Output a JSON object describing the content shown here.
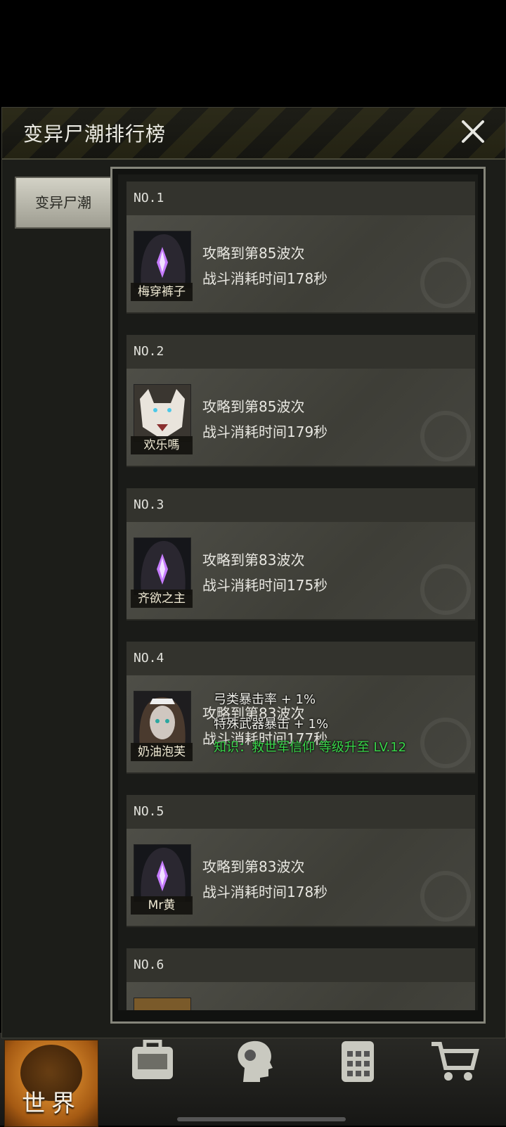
{
  "panel": {
    "title": "变异尸潮排行榜",
    "tab_label": "变异尸潮"
  },
  "ranking": [
    {
      "rank": "NO.1",
      "name": "梅穿裤子",
      "avatar": "hooded-purple-crystal",
      "line1": "攻略到第85波次",
      "line2": "战斗消耗时间178秒"
    },
    {
      "rank": "NO.2",
      "name": "欢乐嗎",
      "avatar": "white-wolf",
      "line1": "攻略到第85波次",
      "line2": "战斗消耗时间179秒"
    },
    {
      "rank": "NO.3",
      "name": "齐欲之主",
      "avatar": "hooded-purple-crystal",
      "line1": "攻略到第83波次",
      "line2": "战斗消耗时间175秒"
    },
    {
      "rank": "NO.4",
      "name": "奶油泡芙",
      "avatar": "maid-girl",
      "line1": "攻略到第83波次",
      "line2": "战斗消耗时间177秒"
    },
    {
      "rank": "NO.5",
      "name": "Mr黄",
      "avatar": "hooded-purple-crystal",
      "line1": "攻略到第83波次",
      "line2": "战斗消耗时间178秒"
    },
    {
      "rank": "NO.6",
      "name": "",
      "avatar": "partial",
      "line1": "",
      "line2": ""
    }
  ],
  "floating_notices": [
    "弓类暴击率 + 1%",
    "特殊武器暴击 + 1%",
    "知识：救世军信仰 等级升至 LV.12"
  ],
  "bottom_nav": {
    "world_label": "世界",
    "icons": [
      "backpack-icon",
      "head-gear-icon",
      "phone-icon",
      "cart-icon"
    ]
  },
  "colors": {
    "notice_green": "#39d64a",
    "world_orange": "#f3a33a"
  }
}
